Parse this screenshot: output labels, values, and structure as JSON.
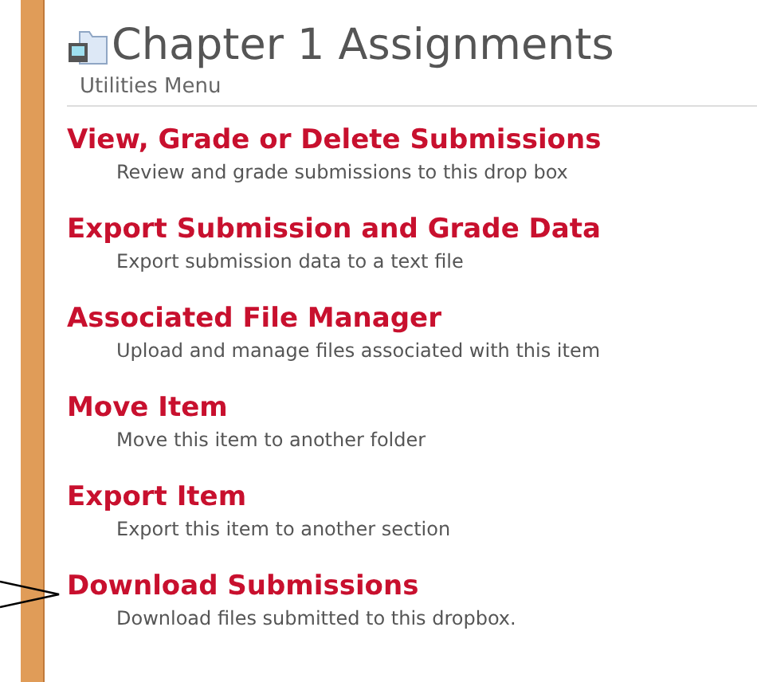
{
  "header": {
    "title": "Chapter 1 Assignments",
    "subtitle": "Utilities Menu"
  },
  "items": [
    {
      "title": "View, Grade or Delete Submissions",
      "description": "Review and grade submissions to this drop box"
    },
    {
      "title": "Export Submission and Grade Data",
      "description": "Export submission data to a text file"
    },
    {
      "title": "Associated File Manager",
      "description": "Upload and manage files associated with this item"
    },
    {
      "title": "Move Item",
      "description": "Move this item to another folder"
    },
    {
      "title": "Export Item",
      "description": "Export this item to another section"
    },
    {
      "title": "Download Submissions",
      "description": "Download files submitted to this dropbox."
    }
  ]
}
